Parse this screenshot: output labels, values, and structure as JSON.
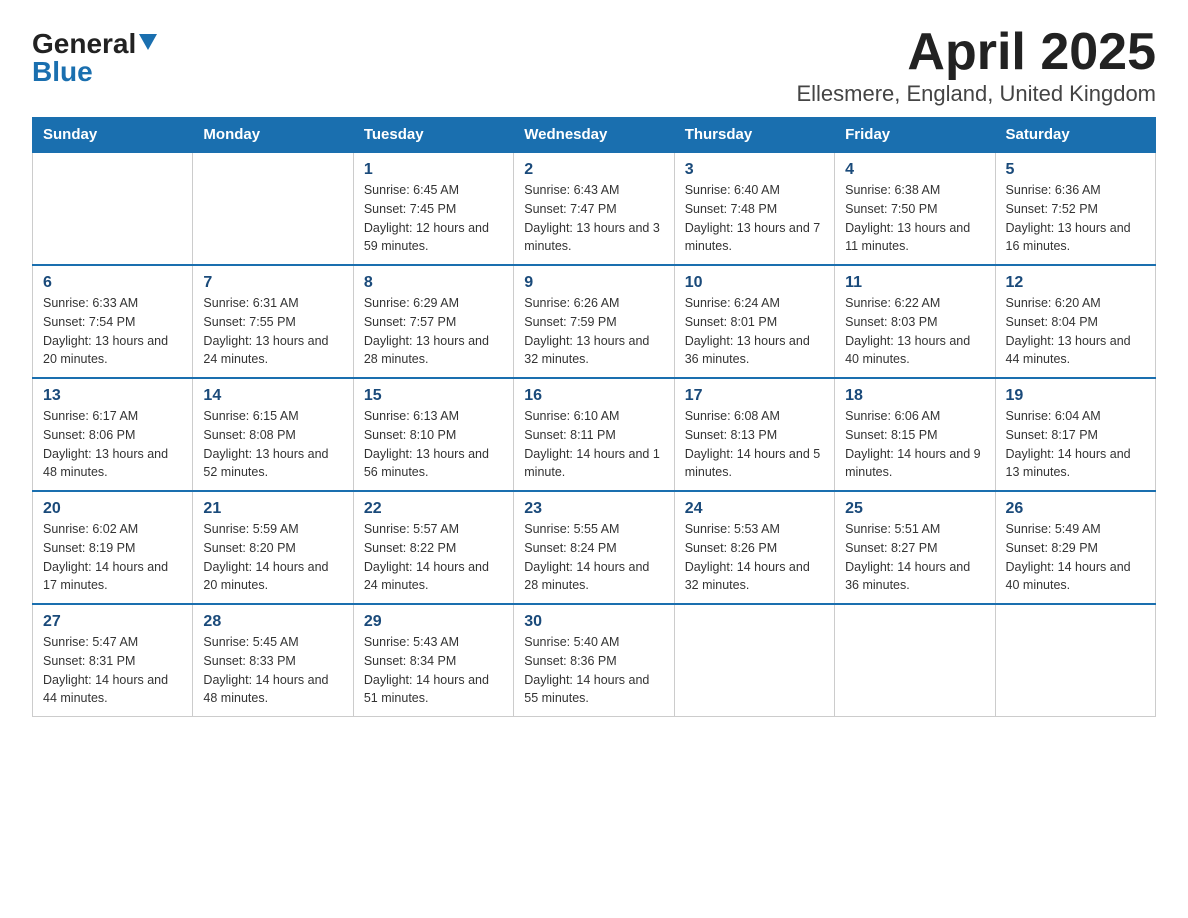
{
  "header": {
    "logo_line1": "General",
    "logo_line2": "Blue",
    "title": "April 2025",
    "subtitle": "Ellesmere, England, United Kingdom"
  },
  "calendar": {
    "days_of_week": [
      "Sunday",
      "Monday",
      "Tuesday",
      "Wednesday",
      "Thursday",
      "Friday",
      "Saturday"
    ],
    "weeks": [
      [
        {
          "day": "",
          "info": ""
        },
        {
          "day": "",
          "info": ""
        },
        {
          "day": "1",
          "info": "Sunrise: 6:45 AM\nSunset: 7:45 PM\nDaylight: 12 hours\nand 59 minutes."
        },
        {
          "day": "2",
          "info": "Sunrise: 6:43 AM\nSunset: 7:47 PM\nDaylight: 13 hours\nand 3 minutes."
        },
        {
          "day": "3",
          "info": "Sunrise: 6:40 AM\nSunset: 7:48 PM\nDaylight: 13 hours\nand 7 minutes."
        },
        {
          "day": "4",
          "info": "Sunrise: 6:38 AM\nSunset: 7:50 PM\nDaylight: 13 hours\nand 11 minutes."
        },
        {
          "day": "5",
          "info": "Sunrise: 6:36 AM\nSunset: 7:52 PM\nDaylight: 13 hours\nand 16 minutes."
        }
      ],
      [
        {
          "day": "6",
          "info": "Sunrise: 6:33 AM\nSunset: 7:54 PM\nDaylight: 13 hours\nand 20 minutes."
        },
        {
          "day": "7",
          "info": "Sunrise: 6:31 AM\nSunset: 7:55 PM\nDaylight: 13 hours\nand 24 minutes."
        },
        {
          "day": "8",
          "info": "Sunrise: 6:29 AM\nSunset: 7:57 PM\nDaylight: 13 hours\nand 28 minutes."
        },
        {
          "day": "9",
          "info": "Sunrise: 6:26 AM\nSunset: 7:59 PM\nDaylight: 13 hours\nand 32 minutes."
        },
        {
          "day": "10",
          "info": "Sunrise: 6:24 AM\nSunset: 8:01 PM\nDaylight: 13 hours\nand 36 minutes."
        },
        {
          "day": "11",
          "info": "Sunrise: 6:22 AM\nSunset: 8:03 PM\nDaylight: 13 hours\nand 40 minutes."
        },
        {
          "day": "12",
          "info": "Sunrise: 6:20 AM\nSunset: 8:04 PM\nDaylight: 13 hours\nand 44 minutes."
        }
      ],
      [
        {
          "day": "13",
          "info": "Sunrise: 6:17 AM\nSunset: 8:06 PM\nDaylight: 13 hours\nand 48 minutes."
        },
        {
          "day": "14",
          "info": "Sunrise: 6:15 AM\nSunset: 8:08 PM\nDaylight: 13 hours\nand 52 minutes."
        },
        {
          "day": "15",
          "info": "Sunrise: 6:13 AM\nSunset: 8:10 PM\nDaylight: 13 hours\nand 56 minutes."
        },
        {
          "day": "16",
          "info": "Sunrise: 6:10 AM\nSunset: 8:11 PM\nDaylight: 14 hours\nand 1 minute."
        },
        {
          "day": "17",
          "info": "Sunrise: 6:08 AM\nSunset: 8:13 PM\nDaylight: 14 hours\nand 5 minutes."
        },
        {
          "day": "18",
          "info": "Sunrise: 6:06 AM\nSunset: 8:15 PM\nDaylight: 14 hours\nand 9 minutes."
        },
        {
          "day": "19",
          "info": "Sunrise: 6:04 AM\nSunset: 8:17 PM\nDaylight: 14 hours\nand 13 minutes."
        }
      ],
      [
        {
          "day": "20",
          "info": "Sunrise: 6:02 AM\nSunset: 8:19 PM\nDaylight: 14 hours\nand 17 minutes."
        },
        {
          "day": "21",
          "info": "Sunrise: 5:59 AM\nSunset: 8:20 PM\nDaylight: 14 hours\nand 20 minutes."
        },
        {
          "day": "22",
          "info": "Sunrise: 5:57 AM\nSunset: 8:22 PM\nDaylight: 14 hours\nand 24 minutes."
        },
        {
          "day": "23",
          "info": "Sunrise: 5:55 AM\nSunset: 8:24 PM\nDaylight: 14 hours\nand 28 minutes."
        },
        {
          "day": "24",
          "info": "Sunrise: 5:53 AM\nSunset: 8:26 PM\nDaylight: 14 hours\nand 32 minutes."
        },
        {
          "day": "25",
          "info": "Sunrise: 5:51 AM\nSunset: 8:27 PM\nDaylight: 14 hours\nand 36 minutes."
        },
        {
          "day": "26",
          "info": "Sunrise: 5:49 AM\nSunset: 8:29 PM\nDaylight: 14 hours\nand 40 minutes."
        }
      ],
      [
        {
          "day": "27",
          "info": "Sunrise: 5:47 AM\nSunset: 8:31 PM\nDaylight: 14 hours\nand 44 minutes."
        },
        {
          "day": "28",
          "info": "Sunrise: 5:45 AM\nSunset: 8:33 PM\nDaylight: 14 hours\nand 48 minutes."
        },
        {
          "day": "29",
          "info": "Sunrise: 5:43 AM\nSunset: 8:34 PM\nDaylight: 14 hours\nand 51 minutes."
        },
        {
          "day": "30",
          "info": "Sunrise: 5:40 AM\nSunset: 8:36 PM\nDaylight: 14 hours\nand 55 minutes."
        },
        {
          "day": "",
          "info": ""
        },
        {
          "day": "",
          "info": ""
        },
        {
          "day": "",
          "info": ""
        }
      ]
    ]
  }
}
